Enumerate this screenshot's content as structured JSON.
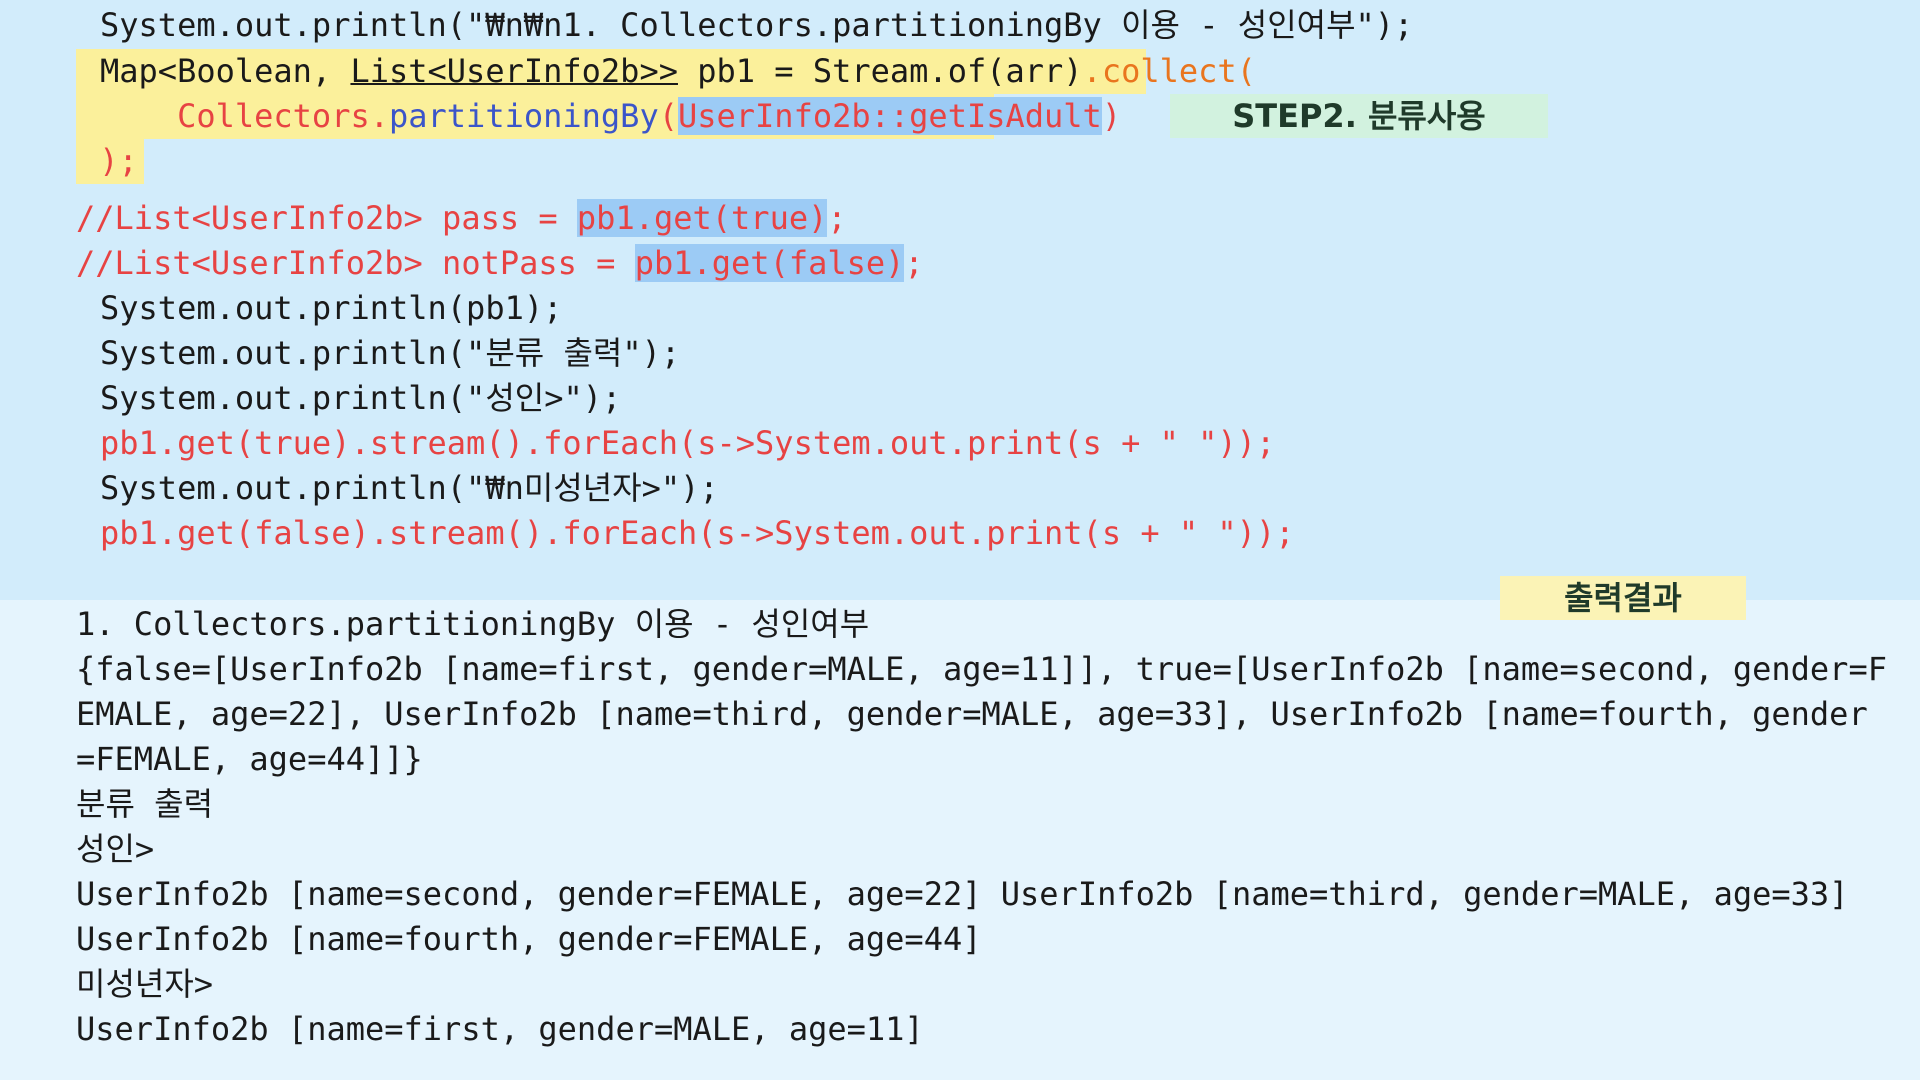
{
  "code_lines": {
    "l1": "System.out.println(\"₩n₩n1. Collectors.partitioningBy 이용 - 성인여부\");",
    "l2_a": "Map<Boolean, ",
    "l2_b": "List<UserInfo2b>>",
    "l2_c": " pb1 = Stream.of(arr)",
    "l2_d": ".collect(",
    "l3_a": "    Collectors.",
    "l3_b": "partitioningBy",
    "l3_c": "(",
    "l3_d": "UserInfo2b::getIsAdult",
    "l3_e": ")",
    "l4_a": " );",
    "l5_a": "//List<UserInfo2b> pass = ",
    "l5_b": "pb1.get(true)",
    "l5_c": ";",
    "l6_a": "//List<UserInfo2b> notPass = ",
    "l6_b": "pb1.get(false)",
    "l6_c": ";",
    "l7": "System.out.println(pb1);",
    "l8": "System.out.println(\"분류 출력\");",
    "l9": "System.out.println(\"성인>\");",
    "l10": "pb1.get(true).stream().forEach(s->System.out.print(s + \" \"));",
    "l11": "System.out.println(\"₩n미성년자>\");",
    "l12": "pb1.get(false).stream().forEach(s->System.out.print(s + \" \"));"
  },
  "labels": {
    "step": "STEP2. 분류사용",
    "output": "출력결과"
  },
  "output_lines": [
    "1. Collectors.partitioningBy 이용 - 성인여부",
    "{false=[UserInfo2b [name=first, gender=MALE, age=11]], true=[UserInfo2b [name=second, gender=F",
    "EMALE, age=22], UserInfo2b [name=third, gender=MALE, age=33], UserInfo2b [name=fourth, gender",
    "=FEMALE, age=44]]}",
    "분류 출력",
    "성인>",
    "UserInfo2b [name=second, gender=FEMALE, age=22] UserInfo2b [name=third, gender=MALE, age=33]",
    "UserInfo2b [name=fourth, gender=FEMALE, age=44]",
    "미성년자>",
    "UserInfo2b [name=first, gender=MALE, age=11]"
  ],
  "colors": {
    "code_bg": "#d2ecfb",
    "output_bg": "#e5f4fd",
    "highlight_yellow": "#fbf09b",
    "highlight_blue": "#9ccbf5",
    "comment_red": "#e74343",
    "method_blue": "#3b55c9"
  }
}
